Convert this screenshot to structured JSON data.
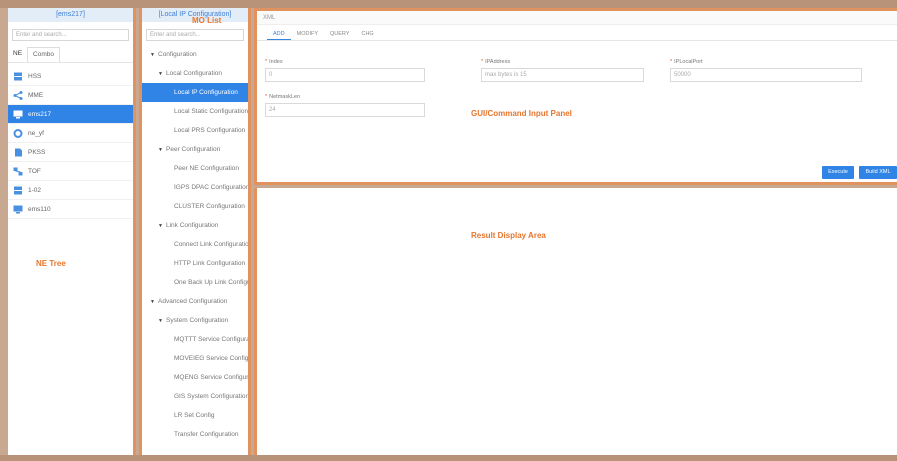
{
  "ne_panel": {
    "header": "[ems217]",
    "search_placeholder": "Enter and search...",
    "tabs": [
      "NE",
      "Combo"
    ],
    "items": [
      {
        "label": "HSS",
        "icon": "server-icon"
      },
      {
        "label": "MME",
        "icon": "share-icon"
      },
      {
        "label": "ems217",
        "icon": "computer-icon",
        "selected": true
      },
      {
        "label": "ne_yf",
        "icon": "gear-icon"
      },
      {
        "label": "PKSS",
        "icon": "document-icon"
      },
      {
        "label": "TOF",
        "icon": "network-icon"
      },
      {
        "label": "1-02",
        "icon": "server-icon"
      },
      {
        "label": "ems110",
        "icon": "computer-icon"
      }
    ],
    "annotation": "NE Tree"
  },
  "mo_panel": {
    "header": "[Local IP Configuration]",
    "search_placeholder": "Enter and search...",
    "annotation": "MO List",
    "tree": [
      {
        "label": "Configuration",
        "level": 0,
        "caret": "down"
      },
      {
        "label": "Local Configuration",
        "level": 1,
        "caret": "down"
      },
      {
        "label": "Local IP Configuration",
        "level": 2,
        "selected": true
      },
      {
        "label": "Local Static Configuration",
        "level": 2
      },
      {
        "label": "Local PRS Configuration",
        "level": 2
      },
      {
        "label": "Peer Configuration",
        "level": 1,
        "caret": "down"
      },
      {
        "label": "Peer NE Configuration",
        "level": 2
      },
      {
        "label": "IGPS DPAC Configuration",
        "level": 2
      },
      {
        "label": "CLUSTER Configuration",
        "level": 2
      },
      {
        "label": "Link Configuration",
        "level": 1,
        "caret": "down"
      },
      {
        "label": "Connect Link Configuration",
        "level": 2
      },
      {
        "label": "HTTP Link Configuration",
        "level": 2
      },
      {
        "label": "One Back Up Link Configuration",
        "level": 2
      },
      {
        "label": "Advanced Configuration",
        "level": 0,
        "caret": "down"
      },
      {
        "label": "System Configuration",
        "level": 1,
        "caret": "down"
      },
      {
        "label": "MQTTT Service Configuration",
        "level": 2
      },
      {
        "label": "MOVEIEG Service Configuration",
        "level": 2
      },
      {
        "label": "MQENG Service Configuration",
        "level": 2
      },
      {
        "label": "GIS System Configuration",
        "level": 2
      },
      {
        "label": "LR Set Config",
        "level": 2
      },
      {
        "label": "Transfer Configuration",
        "level": 2
      }
    ]
  },
  "gui_panel": {
    "title": "XML",
    "tabs": [
      "ADD",
      "MODIFY",
      "QUERY",
      "CHG"
    ],
    "active_tab": "ADD",
    "fields": [
      {
        "label": "Index",
        "value": "0"
      },
      {
        "label": "IPAddress",
        "value": "max bytes is 15"
      },
      {
        "label": "IPLocalPort",
        "value": "50000"
      },
      {
        "label": "NetmaskLen",
        "value": "24"
      }
    ],
    "annotation": "GUI/Command Input Panel",
    "buttons": {
      "execute": "Execute",
      "build_xml": "Build XML"
    }
  },
  "result_panel": {
    "annotation": "Result Display Area"
  },
  "colors": {
    "accent": "#2f84e6",
    "annotation": "#e6762e",
    "border": "#e0925f"
  }
}
